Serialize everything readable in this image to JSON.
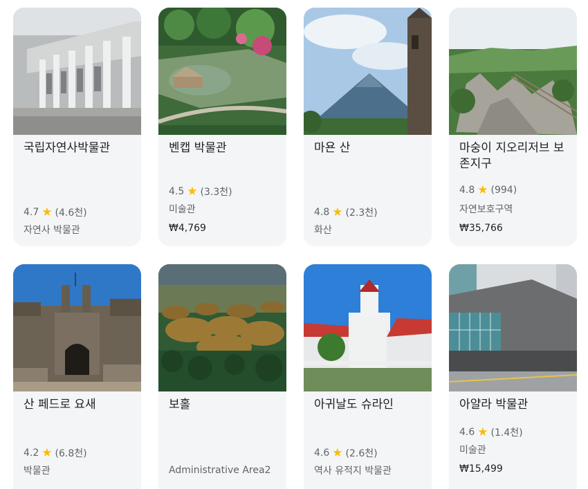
{
  "cards": [
    {
      "title": "국립자연사박물관",
      "rating": "4.7",
      "reviews": "(4.6천)",
      "category": "자연사 박물관"
    },
    {
      "title": "벤캡 박물관",
      "rating": "4.5",
      "reviews": "(3.3천)",
      "category": "미술관",
      "price": "₩4,769"
    },
    {
      "title": "마욘 산",
      "rating": "4.8",
      "reviews": "(2.3천)",
      "category": "화산"
    },
    {
      "title": "마숭이 지오리저브 보존지구",
      "rating": "4.8",
      "reviews": "(994)",
      "category": "자연보호구역",
      "price": "₩35,766"
    },
    {
      "title": "산 페드로 요새",
      "rating": "4.2",
      "reviews": "(6.8천)",
      "category": "박물관"
    },
    {
      "title": "보홀",
      "category": "Administrative Area2"
    },
    {
      "title": "아귀날도 슈라인",
      "rating": "4.6",
      "reviews": "(2.6천)",
      "category": "역사 유적지 박물관"
    },
    {
      "title": "아얄라 박물관",
      "rating": "4.6",
      "reviews": "(1.4천)",
      "category": "미술관",
      "price": "₩15,499"
    }
  ],
  "icons": {
    "star": "star-icon"
  },
  "colors": {
    "star": "#fbbc04",
    "card_bg": "#f4f5f7",
    "text_primary": "#202124",
    "text_secondary": "#5f6368"
  }
}
